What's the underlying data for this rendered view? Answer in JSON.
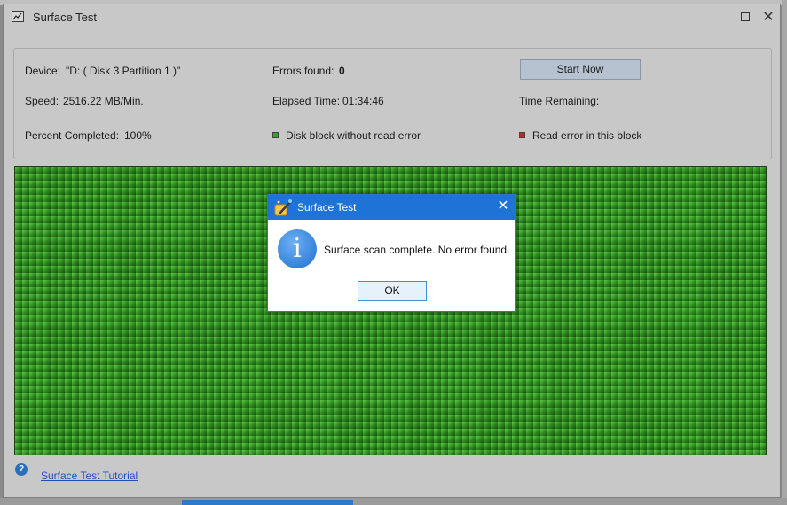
{
  "window": {
    "title": "Surface Test"
  },
  "info": {
    "device_label": "Device:",
    "device_value": "\"D: ( Disk 3 Partition 1 )\"",
    "errors_label": "Errors found:",
    "errors_value": "0",
    "start_button": "Start Now",
    "speed_label": "Speed:",
    "speed_value": "2516.22 MB/Min.",
    "elapsed_label": "Elapsed Time:",
    "elapsed_value": "01:34:46",
    "remaining_label": "Time Remaining:",
    "percent_label": "Percent Completed:",
    "percent_value": "100%",
    "legend_ok": "Disk block without read error",
    "legend_err": "Read error in this block"
  },
  "colors": {
    "block_ok": "#2fa52f",
    "block_err": "#d02020",
    "dialog_title_bg": "#1f72d6"
  },
  "footer": {
    "tutorial_link": "Surface Test Tutorial"
  },
  "dialog": {
    "title": "Surface Test",
    "message": "Surface scan complete. No error found.",
    "ok_button": "OK",
    "icon": "information-icon"
  }
}
